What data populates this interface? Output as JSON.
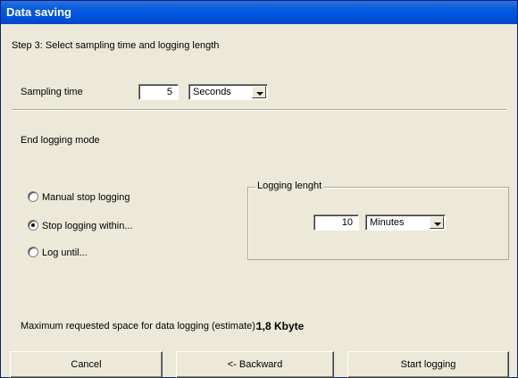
{
  "window": {
    "title": "Data saving"
  },
  "step": {
    "label": "Step 3: Select sampling time and logging length"
  },
  "sampling": {
    "label": "Sampling time",
    "value": "5",
    "unit": "Seconds"
  },
  "end_mode": {
    "label": "End logging mode",
    "options": [
      {
        "label": "Manual stop logging",
        "selected": false
      },
      {
        "label": "Stop logging within...",
        "selected": true
      },
      {
        "label": "Log until...",
        "selected": false
      }
    ]
  },
  "logging_length": {
    "group_label": "Logging lenght",
    "value": "10",
    "unit": "Minutes"
  },
  "estimate": {
    "label": "Maximum requested space for data logging (estimate):",
    "value": "1,8 Kbyte"
  },
  "buttons": {
    "cancel": "Cancel",
    "backward": "<- Backward",
    "start": "Start logging"
  }
}
